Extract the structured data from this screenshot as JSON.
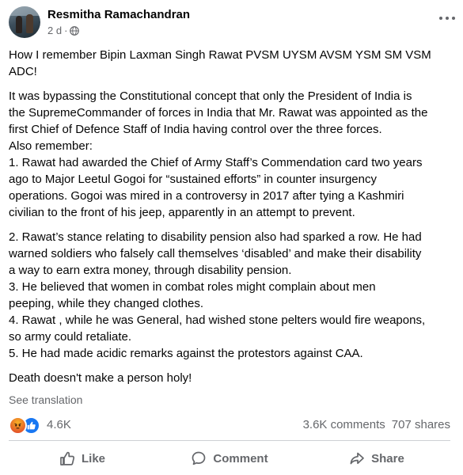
{
  "author": {
    "name": "Resmitha Ramachandran",
    "time": "2 d",
    "separator": "·"
  },
  "post": {
    "paragraphs": [
      [
        "How I remember Bipin Laxman Singh Rawat PVSM UYSM AVSM YSM SM VSM",
        "ADC!"
      ],
      [
        "It was bypassing the Constitutional concept that only the President of India is",
        "the SupremeCommander of forces in India that Mr. Rawat was appointed as the",
        "first  Chief of Defence Staff of India having  control over the three forces.",
        "Also remember:",
        "1.  Rawat had awarded the Chief of Army Staff’s Commendation card two years",
        "ago to Major Leetul Gogoi for “sustained efforts” in counter insurgency",
        "operations. Gogoi was mired in a controversy in 2017 after tying a Kashmiri",
        "civilian to the front of his jeep, apparently in an attempt to prevent."
      ],
      [
        "2. Rawat’s stance relating to disability pension also had  sparked a row.  He had",
        "warned soldiers who falsely call themselves ‘disabled’ and make their disability",
        "a way to earn extra money, through disability pension.",
        "3. He believed that women in combat roles might complain about men",
        "peeping, while they changed clothes.",
        "4.  Rawat , while he was General,  had wished stone pelters would fire weapons,",
        "so army could retaliate.",
        "5. He had made acidic remarks against the protestors against CAA."
      ],
      [
        "Death  doesn't make a person holy!"
      ]
    ]
  },
  "see_translation": "See translation",
  "stats": {
    "reactions": "4.6K",
    "comments": "3.6K comments",
    "shares": "707 shares"
  },
  "actions": {
    "like": "Like",
    "comment": "Comment",
    "share": "Share"
  },
  "colors": {
    "secondary_text": "#65676b",
    "like_blue": "#1877f2",
    "angry_orange": "#e9710f"
  }
}
